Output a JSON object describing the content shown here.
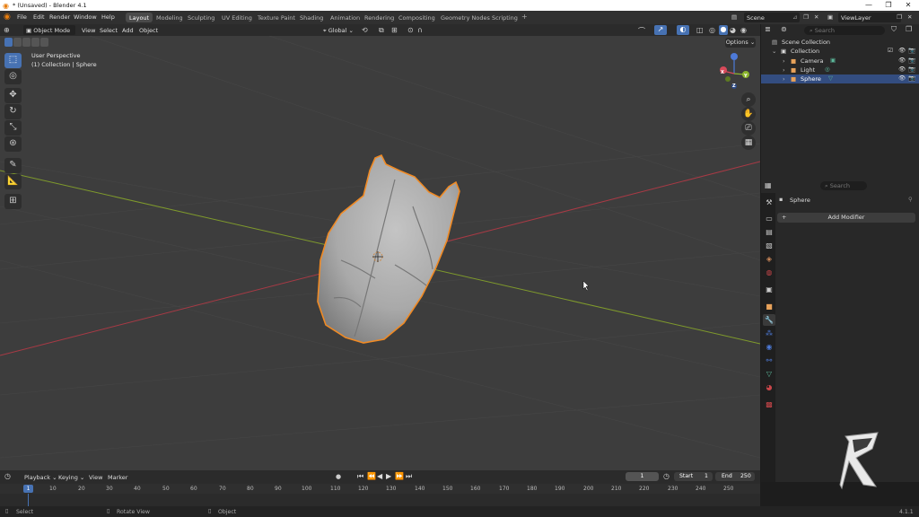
{
  "window": {
    "title": "* (Unsaved) - Blender 4.1",
    "minimize": "—",
    "maximize": "❐",
    "close": "✕"
  },
  "menu": {
    "items": [
      "File",
      "Edit",
      "Render",
      "Window",
      "Help"
    ]
  },
  "workspaces": [
    "Layout",
    "Modeling",
    "Sculpting",
    "UV Editing",
    "Texture Paint",
    "Shading",
    "Animation",
    "Rendering",
    "Compositing",
    "Geometry Nodes",
    "Scripting"
  ],
  "active_workspace": "Layout",
  "scene": {
    "label": "Scene",
    "viewlayer": "ViewLayer"
  },
  "viewport_header": {
    "mode": "Object Mode",
    "view": "View",
    "select": "Select",
    "add": "Add",
    "object": "Object",
    "orientation": "Global",
    "options": "Options"
  },
  "viewport": {
    "perspective": "User Perspective",
    "context": "(1) Collection | Sphere"
  },
  "gizmo": {
    "x": "X",
    "y": "Y",
    "z": "Z"
  },
  "outliner": {
    "search_placeholder": "Search",
    "root": "Scene Collection",
    "collection": "Collection",
    "items": [
      "Camera",
      "Light",
      "Sphere"
    ],
    "selected": "Sphere"
  },
  "properties": {
    "search_placeholder": "Search",
    "object_name": "Sphere",
    "add_modifier": "Add Modifier"
  },
  "timeline": {
    "playback": "Playback",
    "keying": "Keying",
    "view": "View",
    "marker": "Marker",
    "current_frame": "1",
    "start_label": "Start",
    "start": "1",
    "end_label": "End",
    "end": "250",
    "ticks": [
      "1",
      "10",
      "20",
      "30",
      "40",
      "50",
      "60",
      "70",
      "80",
      "90",
      "100",
      "110",
      "120",
      "130",
      "140",
      "150",
      "160",
      "170",
      "180",
      "190",
      "200",
      "210",
      "220",
      "230",
      "240",
      "250"
    ]
  },
  "statusbar": {
    "select": "Select",
    "rotate": "Rotate View",
    "object": "Object",
    "version": "4.1.1"
  },
  "colors": {
    "accent": "#4772b3",
    "selection_outline": "#f08a24",
    "x_axis": "#a83a45",
    "y_axis": "#7f9a2c"
  }
}
